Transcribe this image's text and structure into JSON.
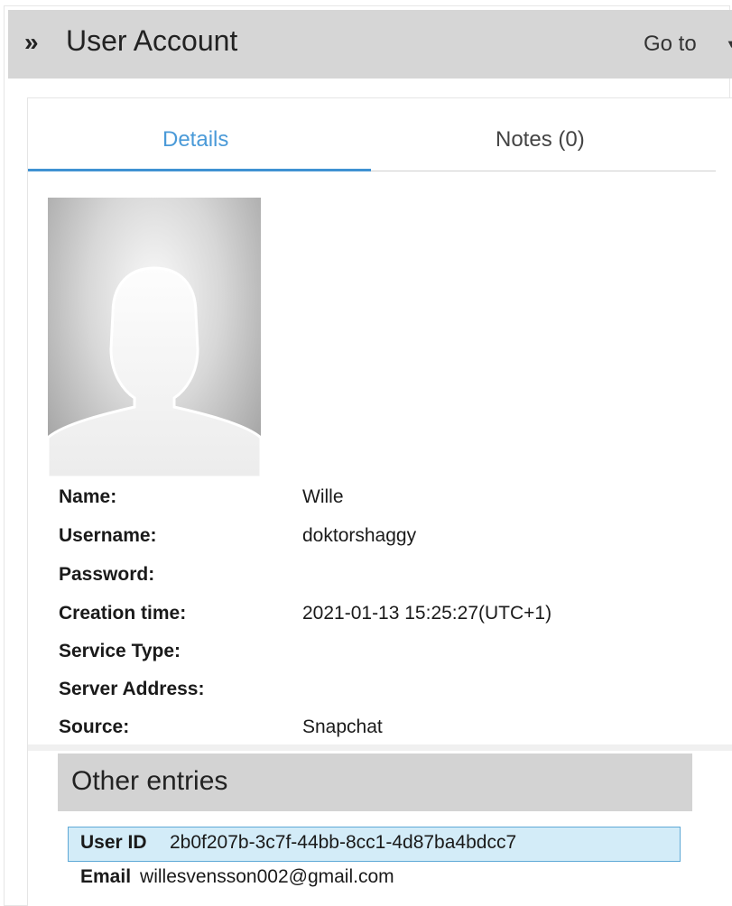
{
  "header": {
    "title": "User Account",
    "goto_label": "Go to",
    "chevron_glyph": "»"
  },
  "tabs": [
    {
      "label": "Details",
      "active": true
    },
    {
      "label": "Notes (0)",
      "active": false
    }
  ],
  "avatar": {
    "icon": "person-silhouette-icon"
  },
  "fields": [
    {
      "label": "Name:",
      "value": "Wille"
    },
    {
      "label": "Username:",
      "value": "doktorshaggy"
    },
    {
      "label": "Password:",
      "value": ""
    },
    {
      "label": "Creation time:",
      "value": "2021-01-13 15:25:27(UTC+1)"
    },
    {
      "label": "Service Type:",
      "value": ""
    },
    {
      "label": "Server Address:",
      "value": ""
    },
    {
      "label": "Source:",
      "value": "Snapchat"
    }
  ],
  "other_entries": {
    "title": "Other entries",
    "items": [
      {
        "key": "User ID",
        "value": "2b0f207b-3c7f-44bb-8cc1-4d87ba4bdcc7",
        "selected": true
      },
      {
        "key": "Email",
        "value": "willesvensson002@gmail.com",
        "selected": false
      }
    ]
  },
  "colors": {
    "accent": "#3f92d2",
    "header_bg": "#d6d6d6",
    "selected_row_bg": "#d3ecf8"
  }
}
